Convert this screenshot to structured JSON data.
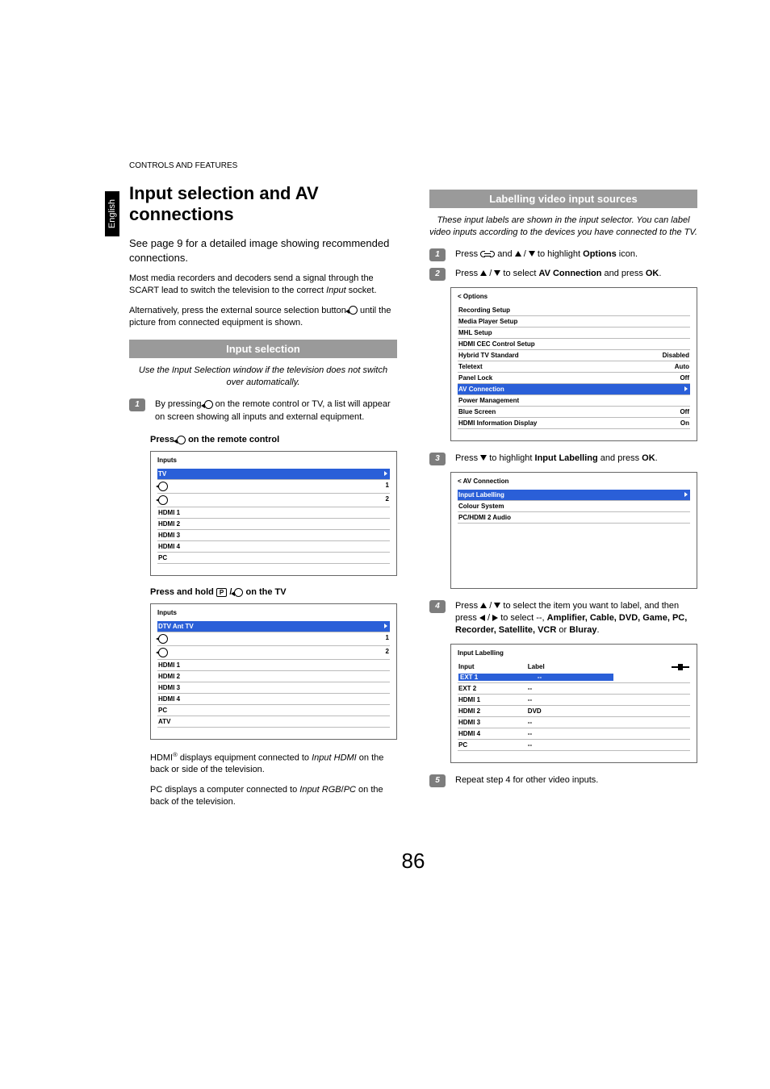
{
  "header": "CONTROLS AND FEATURES",
  "lang_tab": "English",
  "page_number": "86",
  "left": {
    "title": "Input selection and AV connections",
    "p1": "See page 9 for a detailed image showing recommended connections.",
    "p2_a": "Most media recorders and decoders send a signal through the SCART lead to switch the television to the correct ",
    "p2_i": "Input",
    "p2_b": " socket.",
    "p3": "Alternatively, press the external source selection button ",
    "p3_b": " until the picture from connected equipment is shown.",
    "section1": "Input selection",
    "note1": "Use the Input Selection window if the television does not switch over automatically.",
    "step1_a": "By pressing ",
    "step1_b": " on the remote control or TV, a list will appear on screen showing all inputs and external equipment.",
    "instr1_a": "Press ",
    "instr1_b": " on the remote control",
    "menu1_title": "Inputs",
    "menu1_items": [
      "TV",
      "1",
      "2",
      "HDMI 1",
      "HDMI 2",
      "HDMI 3",
      "HDMI 4",
      "PC"
    ],
    "instr2_a": "Press and hold ",
    "instr2_mid": " / ",
    "instr2_b": " on the TV",
    "menu2_title": "Inputs",
    "menu2_items": [
      "DTV Ant TV",
      "1",
      "2",
      "HDMI 1",
      "HDMI 2",
      "HDMI 3",
      "HDMI 4",
      "PC",
      "ATV"
    ],
    "p4_a": "HDMI",
    "p4_b": " displays equipment connected to ",
    "p4_i": "Input HDMI",
    "p4_c": " on the back or side of the television.",
    "p5_a": "PC displays a computer connected to ",
    "p5_i": "Input RGB",
    "p5_b": "/",
    "p5_i2": "PC",
    "p5_c": " on the back of the television."
  },
  "right": {
    "section1": "Labelling video input sources",
    "note1": "These input labels are shown in the input selector. You can label video inputs according to the devices you have connected to the TV.",
    "step1_a": "Press ",
    "step1_b": " and ",
    "step1_c": " / ",
    "step1_d": " to highlight ",
    "step1_opt": "Options",
    "step1_e": " icon.",
    "step2_a": "Press ",
    "step2_b": " / ",
    "step2_c": " to select ",
    "step2_opt": "AV Connection",
    "step2_d": " and press ",
    "step2_ok": "OK",
    "step2_e": ".",
    "menu1_title": "< Options",
    "menu1_rows": [
      {
        "l": "Recording Setup",
        "r": ""
      },
      {
        "l": "Media Player Setup",
        "r": ""
      },
      {
        "l": "MHL Setup",
        "r": ""
      },
      {
        "l": "HDMI CEC Control Setup",
        "r": ""
      },
      {
        "l": "Hybrid TV Standard",
        "r": "Disabled"
      },
      {
        "l": "Teletext",
        "r": "Auto"
      },
      {
        "l": "Panel Lock",
        "r": "Off"
      },
      {
        "l": "AV Connection",
        "r": "",
        "sel": true
      },
      {
        "l": "Power Management",
        "r": ""
      },
      {
        "l": "Blue Screen",
        "r": "Off"
      },
      {
        "l": "HDMI Information Display",
        "r": "On"
      }
    ],
    "step3_a": "Press ",
    "step3_b": " to highlight ",
    "step3_opt": "Input Labelling",
    "step3_c": " and press ",
    "step3_ok": "OK",
    "step3_d": ".",
    "menu2_title": "< AV Connection",
    "menu2_rows": [
      {
        "l": "Input Labelling",
        "sel": true
      },
      {
        "l": "Colour System"
      },
      {
        "l": "PC/HDMI 2 Audio"
      }
    ],
    "step4_a": "Press ",
    "step4_b": " / ",
    "step4_c": " to select the item you want to label, and then press ",
    "step4_d": " / ",
    "step4_e": " to select --, ",
    "step4_opts": "Amplifier, Cable, DVD, Game, PC, Recorder, Satellite, VCR",
    "step4_or": " or ",
    "step4_last": "Bluray",
    "step4_f": ".",
    "menu3_title": "Input Labelling",
    "menu3_h1": "Input",
    "menu3_h2": "Label",
    "menu3_rows": [
      {
        "input": "EXT 1",
        "label": "--",
        "sel": true
      },
      {
        "input": "EXT 2",
        "label": "--"
      },
      {
        "input": "HDMI 1",
        "label": "--"
      },
      {
        "input": "HDMI 2",
        "label": "DVD"
      },
      {
        "input": "HDMI 3",
        "label": "--"
      },
      {
        "input": "HDMI 4",
        "label": "--"
      },
      {
        "input": "PC",
        "label": "--"
      }
    ],
    "step5": "Repeat step 4 for other video inputs."
  }
}
